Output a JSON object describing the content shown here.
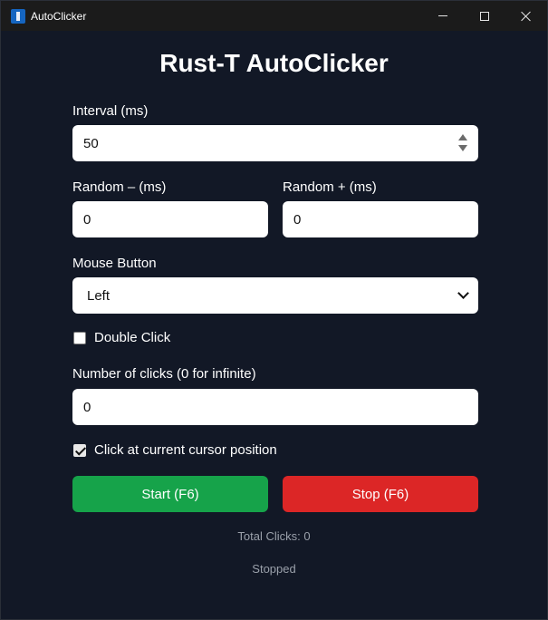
{
  "window": {
    "title": "AutoClicker"
  },
  "app": {
    "heading": "Rust-T AutoClicker"
  },
  "interval": {
    "label": "Interval (ms)",
    "value": "50"
  },
  "random_minus": {
    "label": "Random – (ms)",
    "value": "0"
  },
  "random_plus": {
    "label": "Random + (ms)",
    "value": "0"
  },
  "mouse_button": {
    "label": "Mouse Button",
    "selected": "Left"
  },
  "double_click": {
    "label": "Double Click",
    "checked": false
  },
  "num_clicks": {
    "label": "Number of clicks (0 for infinite)",
    "value": "0"
  },
  "cursor_position": {
    "label": "Click at current cursor position",
    "checked": true
  },
  "buttons": {
    "start_label": "Start (F6)",
    "stop_label": "Stop (F6)",
    "start_color": "#16a34a",
    "stop_color": "#dc2626"
  },
  "status": {
    "total_clicks": "Total Clicks: 0",
    "state": "Stopped"
  },
  "icons": {
    "app": "app-icon",
    "minimize": "minimize-icon",
    "maximize": "maximize-icon",
    "close": "close-icon"
  }
}
